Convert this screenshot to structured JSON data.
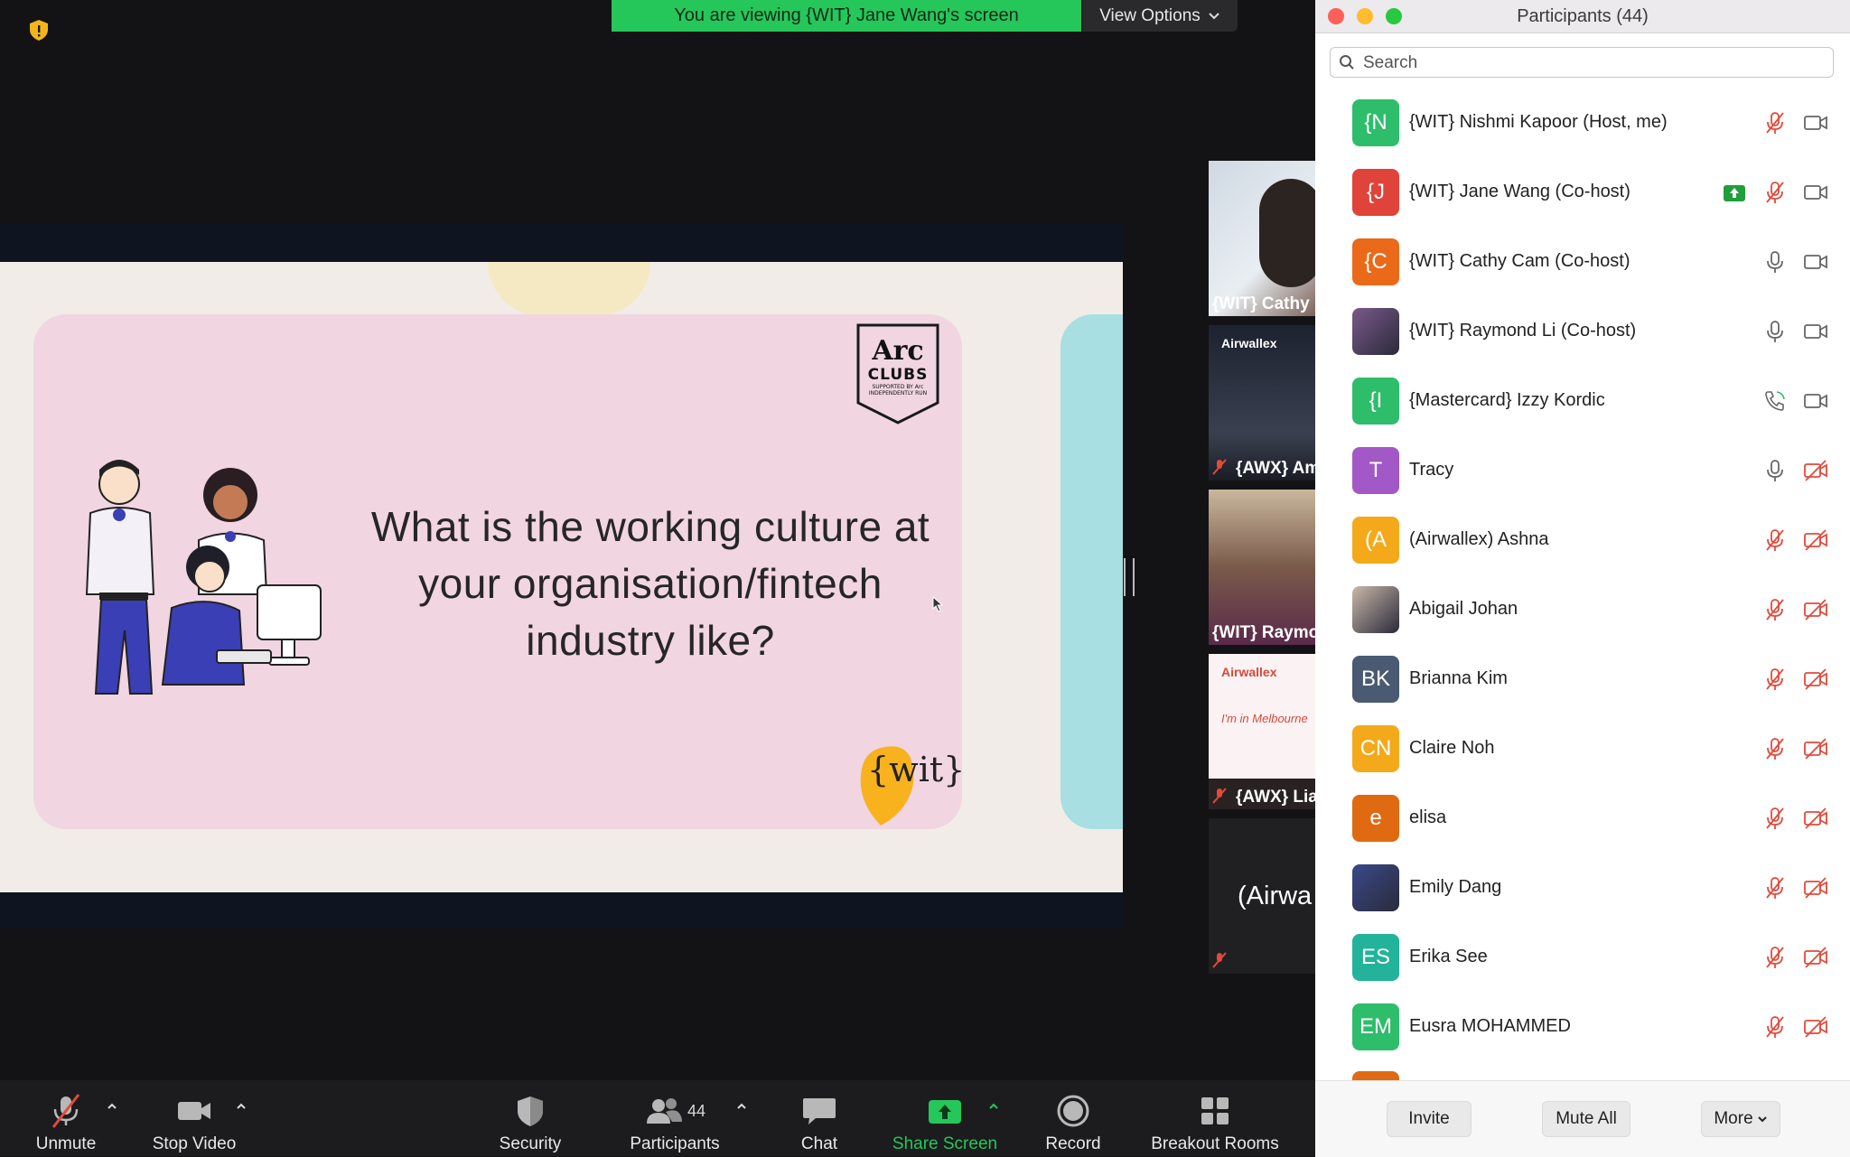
{
  "banner": {
    "viewing": "You are viewing {WIT} Jane Wang's screen",
    "view_options": "View Options"
  },
  "slide": {
    "question": "What is the working culture at your organisation/fintech industry like?",
    "logo_top": "Arc",
    "logo_mid": "CLUBS",
    "logo_sub1": "SUPPORTED BY Arc",
    "logo_sub2": "INDEPENDENTLY RUN",
    "logo_bottom": "{wit}"
  },
  "thumbnails": [
    {
      "label": "{WIT} Cathy",
      "muted": false
    },
    {
      "label": "{AWX} Am",
      "logo": "Airwallex",
      "muted": true
    },
    {
      "label": "{WIT} Raymo",
      "muted": false
    },
    {
      "label": "{AWX} Lia",
      "logo": "Airwallex",
      "extra": "I'm in Melbourne",
      "muted": true
    },
    {
      "label": "(Airwa",
      "muted": true
    }
  ],
  "panel": {
    "title": "Participants (44)",
    "search_placeholder": "Search",
    "participants": [
      {
        "initials": "{N",
        "name": "{WIT} Nishmi Kapoor (Host, me)",
        "color": "#2ebd6b",
        "mic": "muted",
        "cam": "on"
      },
      {
        "initials": "{J",
        "name": "{WIT} Jane Wang (Co-host)",
        "color": "#e0433a",
        "mic": "muted",
        "cam": "on",
        "sharing": true
      },
      {
        "initials": "{C",
        "name": "{WIT} Cathy Cam (Co-host)",
        "color": "#ea6a1a",
        "mic": "on",
        "cam": "on"
      },
      {
        "initials": "",
        "name": "{WIT} Raymond Li (Co-host)",
        "color": "#7a5a8a",
        "mic": "on",
        "cam": "on",
        "photo": true
      },
      {
        "initials": "{I",
        "name": "{Mastercard} Izzy Kordic",
        "color": "#2ebd6b",
        "mic": "phone",
        "cam": "on"
      },
      {
        "initials": "T",
        "name": "Tracy",
        "color": "#a258c6",
        "mic": "on",
        "cam": "off"
      },
      {
        "initials": "(A",
        "name": "(Airwallex) Ashna",
        "color": "#f4a91b",
        "mic": "muted",
        "cam": "off"
      },
      {
        "initials": "",
        "name": "Abigail Johan",
        "color": "#c9b8a8",
        "mic": "muted",
        "cam": "off",
        "photo": true
      },
      {
        "initials": "BK",
        "name": "Brianna Kim",
        "color": "#4a5a72",
        "mic": "muted",
        "cam": "off"
      },
      {
        "initials": "CN",
        "name": "Claire Noh",
        "color": "#f4a91b",
        "mic": "muted",
        "cam": "off"
      },
      {
        "initials": "e",
        "name": "elisa",
        "color": "#e06a12",
        "mic": "muted",
        "cam": "off"
      },
      {
        "initials": "",
        "name": "Emily Dang",
        "color": "#3a4a8a",
        "mic": "muted",
        "cam": "off",
        "photo": true
      },
      {
        "initials": "ES",
        "name": "Erika See",
        "color": "#22b39a",
        "mic": "muted",
        "cam": "off"
      },
      {
        "initials": "EM",
        "name": "Eusra MOHAMMED",
        "color": "#2ebd6b",
        "mic": "muted",
        "cam": "off"
      }
    ],
    "footer": {
      "invite": "Invite",
      "mute_all": "Mute All",
      "more": "More"
    }
  },
  "toolbar": {
    "unmute": "Unmute",
    "stop_video": "Stop Video",
    "security": "Security",
    "participants": "Participants",
    "participants_count": "44",
    "chat": "Chat",
    "share_screen": "Share Screen",
    "record": "Record",
    "breakout_rooms": "Breakout Rooms"
  },
  "colors": {
    "share_green": "#25c75a",
    "muted_red": "#e24a3b",
    "panel_bg": "#ffffff",
    "toolbar_bg": "#1c1c1e"
  }
}
